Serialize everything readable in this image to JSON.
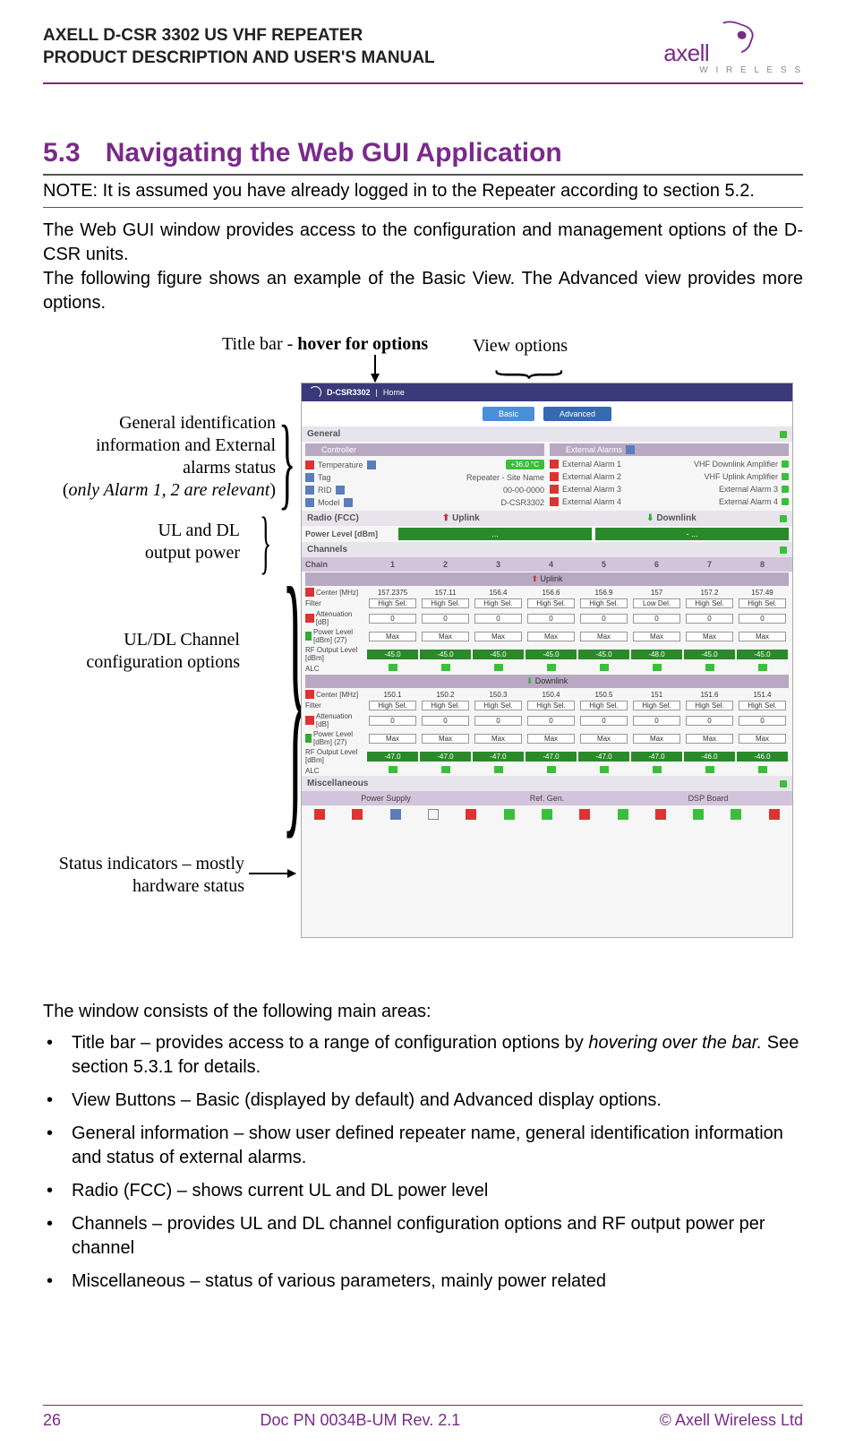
{
  "header": {
    "line1": "AXELL D-CSR 3302 US VHF REPEATER",
    "line2": "PRODUCT DESCRIPTION AND USER'S MANUAL",
    "logo_text": "axell",
    "logo_sub": "W I R E L E S S"
  },
  "section": {
    "number": "5.3",
    "title": "Navigating the Web GUI Application"
  },
  "note": "NOTE: It is assumed you have already logged in to the Repeater according to section 5.2.",
  "para1": "The Web GUI window provides access to the configuration and management options of the D-CSR units.",
  "para2": "The following figure shows an example of the Basic View. The Advanced view provides more options.",
  "figure_labels": {
    "title_bar_pre": "Title bar - ",
    "title_bar_bold": "hover for options",
    "view_options": "View options",
    "general_l1": "General identification",
    "general_l2": "information and External",
    "general_l3": "alarms status",
    "general_l4_pre": "(",
    "general_l4_it": "only Alarm 1, 2 are relevant",
    "general_l4_post": ")",
    "uldl_l1": "UL and DL",
    "uldl_l2": "output power",
    "chan_l1": "UL/DL Channel",
    "chan_l2": "configuration options",
    "status_l1": "Status indicators – mostly",
    "status_l2": "hardware status"
  },
  "screenshot": {
    "title": "D-CSR3302",
    "title_sep": " | ",
    "title_page": "Home",
    "btn_basic": "Basic",
    "btn_advanced": "Advanced",
    "general_hdr": "General",
    "controller": "Controller",
    "ext_alarms_hdr": "External Alarms",
    "rows_left": {
      "temp": "Temperature",
      "temp_val": "+36.0 °C",
      "tag": "Tag",
      "tag_val": "Repeater - Site Name",
      "rid": "RID",
      "rid_val": "00-00-0000",
      "model": "Model",
      "model_val": "D-CSR3302"
    },
    "ext_rows": [
      {
        "n": "1",
        "label": "External Alarm 1",
        "val": "VHF Downlink Amplifier"
      },
      {
        "n": "2",
        "label": "External Alarm 2",
        "val": "VHF Uplink Amplifier"
      },
      {
        "n": "3",
        "label": "External Alarm 3",
        "val": "External Alarm 3"
      },
      {
        "n": "4",
        "label": "External Alarm 4",
        "val": "External Alarm 4"
      }
    ],
    "radio_hdr": "Radio (FCC)",
    "uplink": "Uplink",
    "downlink": "Downlink",
    "power_level": "Power Level [dBm]",
    "power_uplink_val": "...",
    "power_downlink_val": "- ...",
    "channels_hdr": "Channels",
    "chan_label": "Chain",
    "chan_nums": [
      "1",
      "2",
      "3",
      "4",
      "5",
      "6",
      "7",
      "8"
    ],
    "uplink_bar": "Uplink",
    "downlink_bar": "Downlink",
    "center_label": "Center [MHz]",
    "filter_label": "Filter",
    "atten_label": "Attenuation [dB]",
    "power_label": "Power Level [dBm] (27)",
    "rf_label": "RF Output Level [dBm]",
    "alc_label": "ALC",
    "high_sel": "High Sel.",
    "low_del": "Low Del.",
    "max": "Max",
    "zero": "0",
    "uplink_center": [
      "157.2375",
      "157.11",
      "156.4",
      "156.6",
      "156.9",
      "157",
      "157.2",
      "157.49"
    ],
    "uplink_filter": [
      "High Sel.",
      "High Sel.",
      "High Sel.",
      "High Sel.",
      "High Sel.",
      "Low Del.",
      "High Sel.",
      "High Sel."
    ],
    "uplink_rf": [
      "-45.0",
      "-45.0",
      "-45.0",
      "-45.0",
      "-45.0",
      "-48.0",
      "-45.0",
      "-45.0"
    ],
    "downlink_center": [
      "150.1",
      "150.2",
      "150.3",
      "150.4",
      "150.5",
      "151",
      "151.6",
      "151.4"
    ],
    "downlink_rf": [
      "-47.0",
      "-47.0",
      "-47.0",
      "-47.0",
      "-47.0",
      "-47.0",
      "-46.0",
      "-46.0"
    ],
    "misc_hdr": "Miscellaneous",
    "misc_cols": [
      "Power Supply",
      "Ref. Gen.",
      "DSP Board"
    ]
  },
  "areas_intro": "The window consists of the following main areas:",
  "areas": [
    {
      "pre": "Title bar – provides access to a range of configuration options by ",
      "ital": "hovering over the bar.",
      "post": " See section 5.3.1 for details."
    },
    {
      "pre": "View Buttons – Basic (displayed by default) and Advanced display options.",
      "ital": "",
      "post": ""
    },
    {
      "pre": "General information – show user defined repeater name, general identification information and status of external alarms.",
      "ital": "",
      "post": ""
    },
    {
      "pre": "Radio (FCC) –  shows current UL and DL power level",
      "ital": "",
      "post": ""
    },
    {
      "pre": "Channels – provides UL and DL channel configuration options and RF output power per channel",
      "ital": "",
      "post": ""
    },
    {
      "pre": "Miscellaneous – status of various parameters, mainly power related",
      "ital": "",
      "post": ""
    }
  ],
  "footer": {
    "page": "26",
    "doc": "Doc PN 0034B-UM Rev. 2.1",
    "copy": "© Axell Wireless Ltd"
  }
}
